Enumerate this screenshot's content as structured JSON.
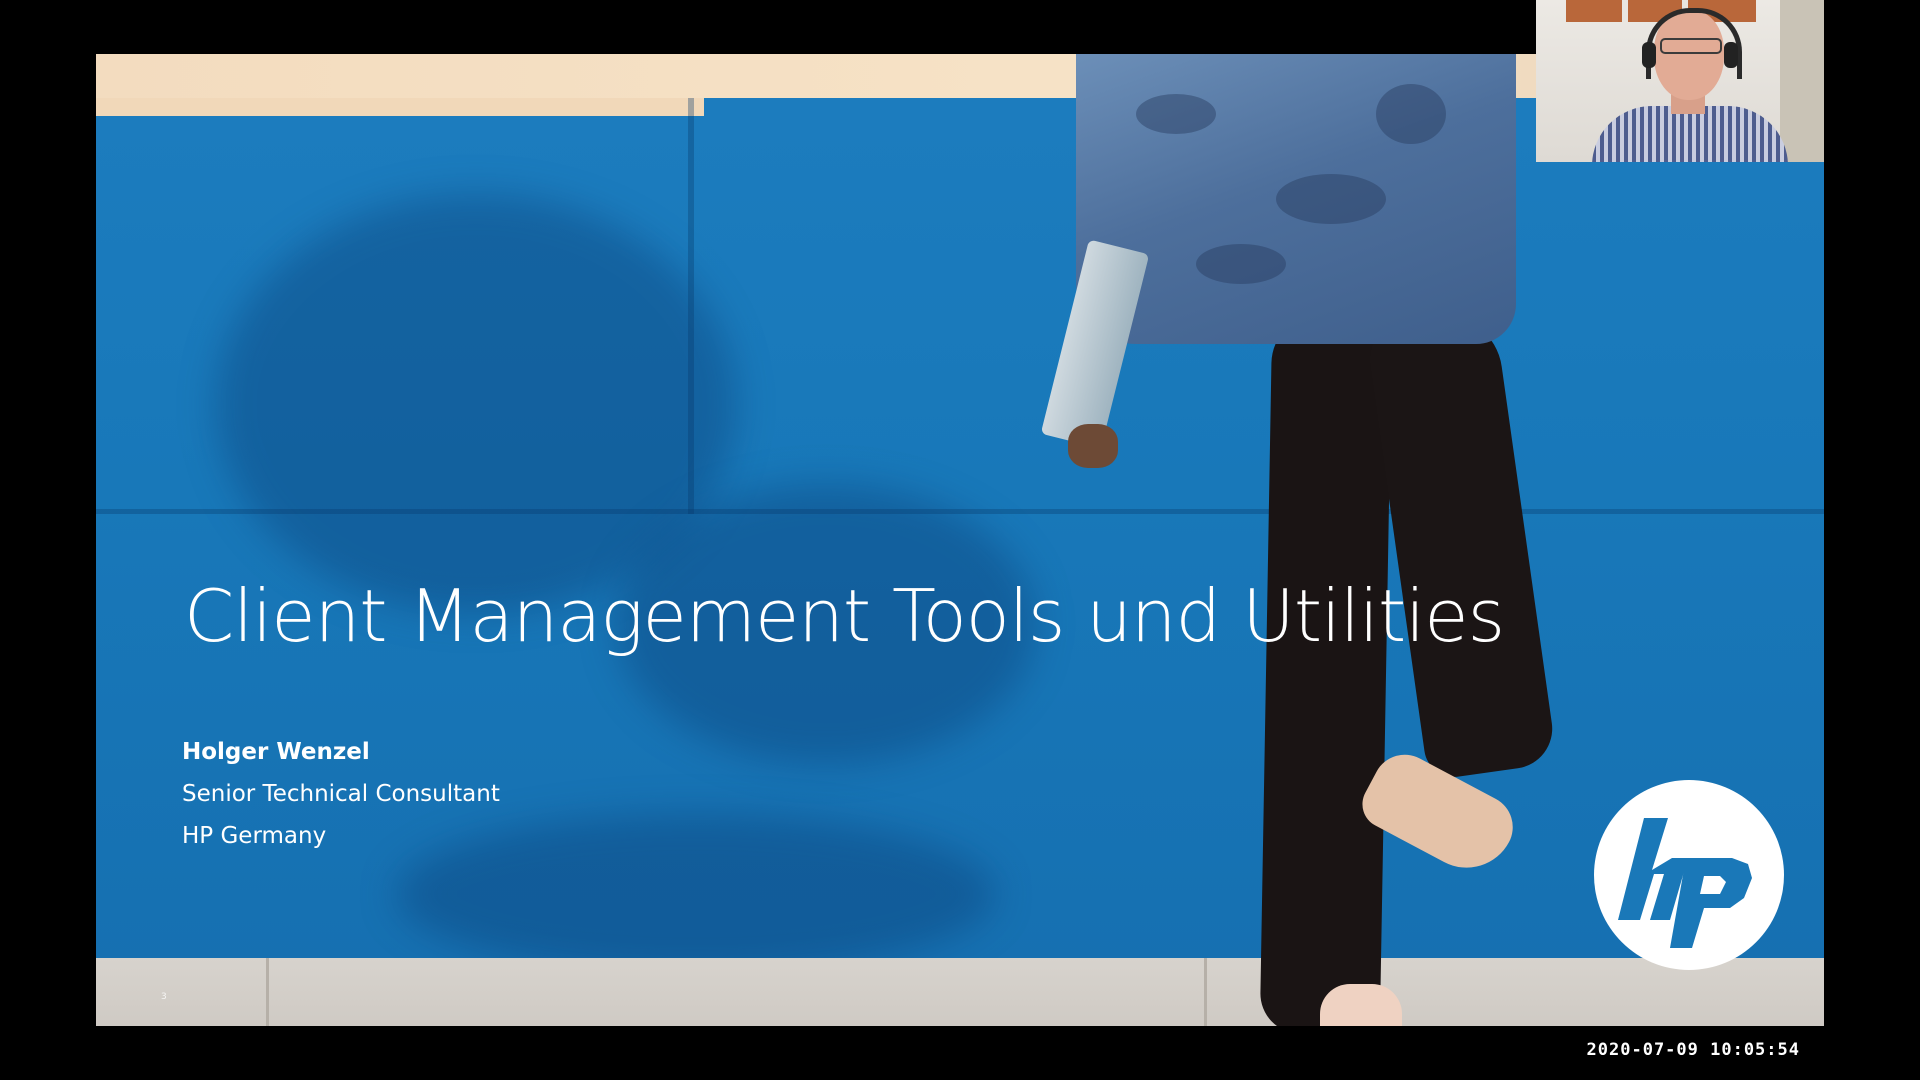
{
  "slide": {
    "title": "Client Management Tools und Utilities",
    "presenter": {
      "name": "Holger Wenzel",
      "role": "Senior Technical Consultant",
      "company": "HP Germany"
    },
    "slide_number": "3",
    "logo": {
      "icon": "hp-logo-icon",
      "text": "hp"
    },
    "colors": {
      "wall_blue": "#1a78b8",
      "text": "#ffffff"
    }
  },
  "webcam": {
    "icon": "webcam-feed"
  },
  "recording": {
    "timestamp": "2020-07-09  10:05:54"
  }
}
